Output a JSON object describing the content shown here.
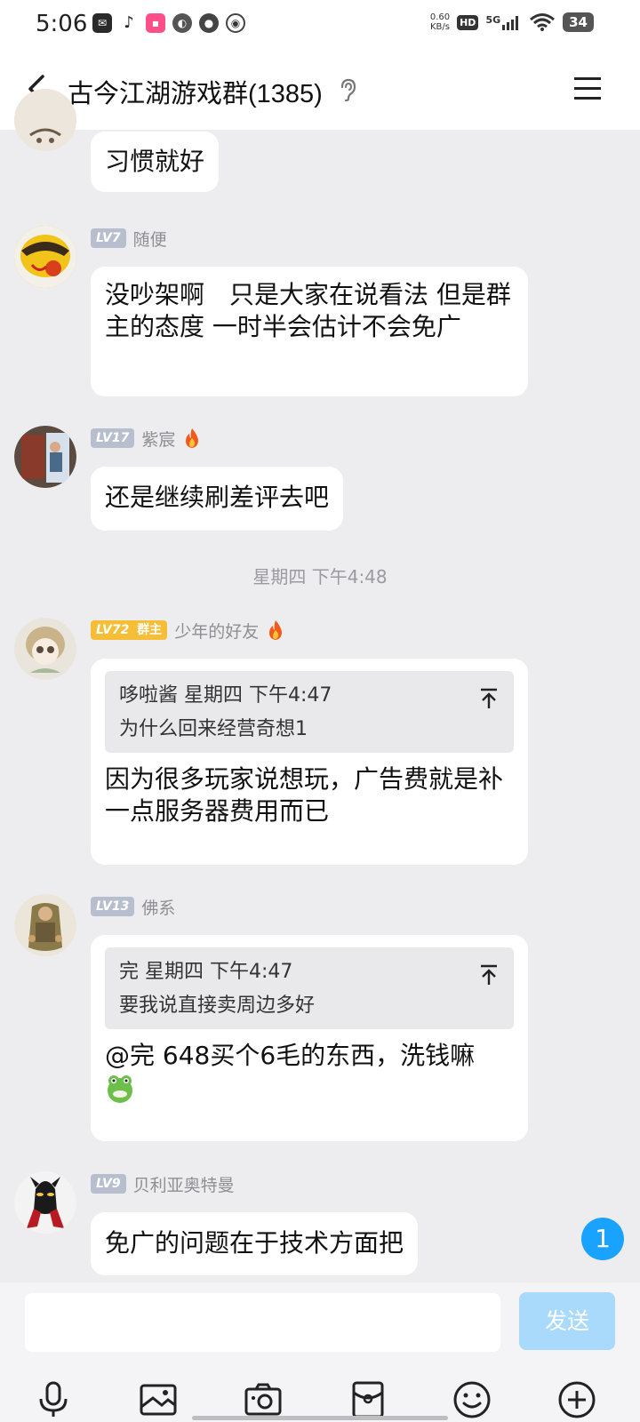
{
  "status_bar": {
    "time": "5:06",
    "speed_value": "0.60",
    "speed_unit": "KB/s",
    "hd": "HD",
    "network": "5G",
    "battery": "34"
  },
  "header": {
    "title": "古今江湖游戏群(1385)"
  },
  "messages": [
    {
      "text": "习惯就好"
    },
    {
      "level": "LV7",
      "name": "随便",
      "text": "没吵架啊　只是大家在说看法  但是群主的态度  一时半会估计不会免广"
    },
    {
      "level": "LV17",
      "name": "紫宸",
      "text": "还是继续刷差评去吧"
    },
    {
      "level": "LV72",
      "role": "群主",
      "name": "少年的好友",
      "quote_head": "哆啦酱  星期四  下午4:47",
      "quote_body": "为什么回来经营奇想1",
      "text": "因为很多玩家说想玩，广告费就是补一点服务器费用而已"
    },
    {
      "level": "LV13",
      "name": "佛系",
      "quote_head": "完  星期四  下午4:47",
      "quote_body": "要我说直接卖周边多好",
      "text": "@完  648买个6毛的东西，洗钱嘛"
    },
    {
      "level": "LV9",
      "name": "贝利亚奥特曼",
      "text": "免广的问题在于技术方面把"
    }
  ],
  "timestamp_divider": "星期四  下午4:48",
  "unread_count": "1",
  "input": {
    "send_label": "发送",
    "placeholder": ""
  },
  "toolbar_icons": [
    "microphone-icon",
    "image-icon",
    "camera-icon",
    "red-packet-icon",
    "emoji-icon",
    "plus-icon"
  ],
  "colors": {
    "accent": "#1aa2ff",
    "send_disabled": "#a9d9fb",
    "level_badge": "#b7bfcf",
    "owner_badge": "#f6bd36",
    "chat_background": "#ededf0"
  }
}
